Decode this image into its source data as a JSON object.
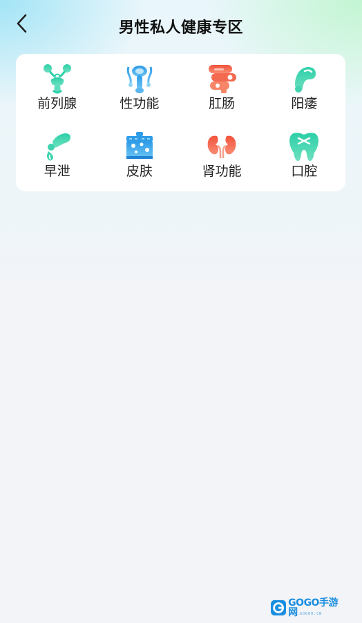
{
  "header": {
    "title": "男性私人健康专区",
    "back_icon": "chevron-left-icon"
  },
  "categories": [
    {
      "label": "前列腺",
      "icon": "prostate-icon",
      "color": "#2fd0a8"
    },
    {
      "label": "性功能",
      "icon": "reproductive-system-icon",
      "color": "#3aa8e8"
    },
    {
      "label": "肛肠",
      "icon": "intestine-icon",
      "color": "#f4664a"
    },
    {
      "label": "阳痿",
      "icon": "impotence-icon",
      "color": "#2fd0a8"
    },
    {
      "label": "早泄",
      "icon": "premature-ejaculation-icon",
      "color": "#2fd0a8"
    },
    {
      "label": "皮肤",
      "icon": "skin-icon",
      "color": "#3aa8e8"
    },
    {
      "label": "肾功能",
      "icon": "kidney-icon",
      "color": "#f4664a"
    },
    {
      "label": "口腔",
      "icon": "tooth-icon",
      "color": "#2fd0a8"
    }
  ],
  "watermark": {
    "text": "GOGO手游网",
    "sub": "WWW.GOGOO.CN"
  }
}
